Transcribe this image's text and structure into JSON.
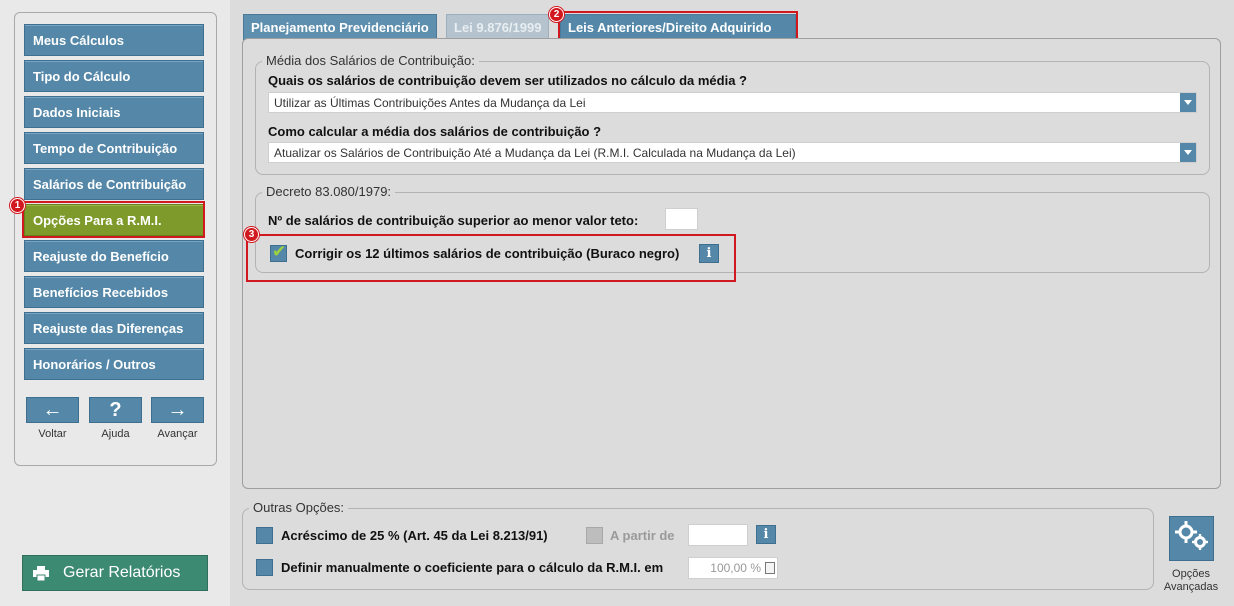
{
  "sidebar": {
    "items": [
      {
        "label": "Meus Cálculos"
      },
      {
        "label": "Tipo do Cálculo"
      },
      {
        "label": "Dados Iniciais"
      },
      {
        "label": "Tempo de Contribuição"
      },
      {
        "label": "Salários de Contribuição"
      },
      {
        "label": "Opções Para a R.M.I."
      },
      {
        "label": "Reajuste do Benefício"
      },
      {
        "label": "Benefícios Recebidos"
      },
      {
        "label": "Reajuste das Diferenças"
      },
      {
        "label": "Honorários / Outros"
      }
    ],
    "active_index": 5,
    "nav": {
      "back_label": "Voltar",
      "help_label": "Ajuda",
      "next_label": "Avançar",
      "back_glyph": "←",
      "help_glyph": "?",
      "next_glyph": "→"
    },
    "report_button": "Gerar Relatórios"
  },
  "tabs": [
    {
      "label": "Planejamento Previdenciário",
      "state": "normal"
    },
    {
      "label": "Lei 9.876/1999",
      "state": "dimmed"
    },
    {
      "label": "Leis Anteriores/Direito Adquirido",
      "state": "active"
    }
  ],
  "markers": {
    "m1": "1",
    "m2": "2",
    "m3": "3"
  },
  "media_group": {
    "legend": "Média dos Salários de Contribuição:",
    "q1": "Quais os salários de contribuição devem ser utilizados no cálculo da média ?",
    "q1_value": "Utilizar as Últimas Contribuições Antes da Mudança da Lei",
    "q2": "Como calcular a média dos salários de contribuição ?",
    "q2_value": "Atualizar os Salários de Contribuição Até a Mudança da Lei (R.M.I. Calculada na Mudança da Lei)"
  },
  "decreto_group": {
    "legend": "Decreto 83.080/1979:",
    "teto_label": "Nº de salários de contribuição superior ao menor valor teto:",
    "teto_value": "",
    "corrigir_label": "Corrigir os 12 últimos salários de contribuição (Buraco negro)",
    "corrigir_checked": true,
    "info_glyph": "i"
  },
  "outras": {
    "legend": "Outras Opções:",
    "acrescimo_label": "Acréscimo de 25 % (Art. 45 da Lei 8.213/91)",
    "apartir_label": "A partir de",
    "apartir_value": "",
    "definir_label": "Definir manualmente o coeficiente para o cálculo da R.M.I. em",
    "coef_value": "100,00 %",
    "info_glyph": "i"
  },
  "advanced": {
    "label_line1": "Opções",
    "label_line2": "Avançadas"
  },
  "colors": {
    "button_blue": "#5588a8",
    "active_green": "#7e9a2a",
    "report_green": "#3d8a73",
    "highlight_red": "#d1181f"
  }
}
